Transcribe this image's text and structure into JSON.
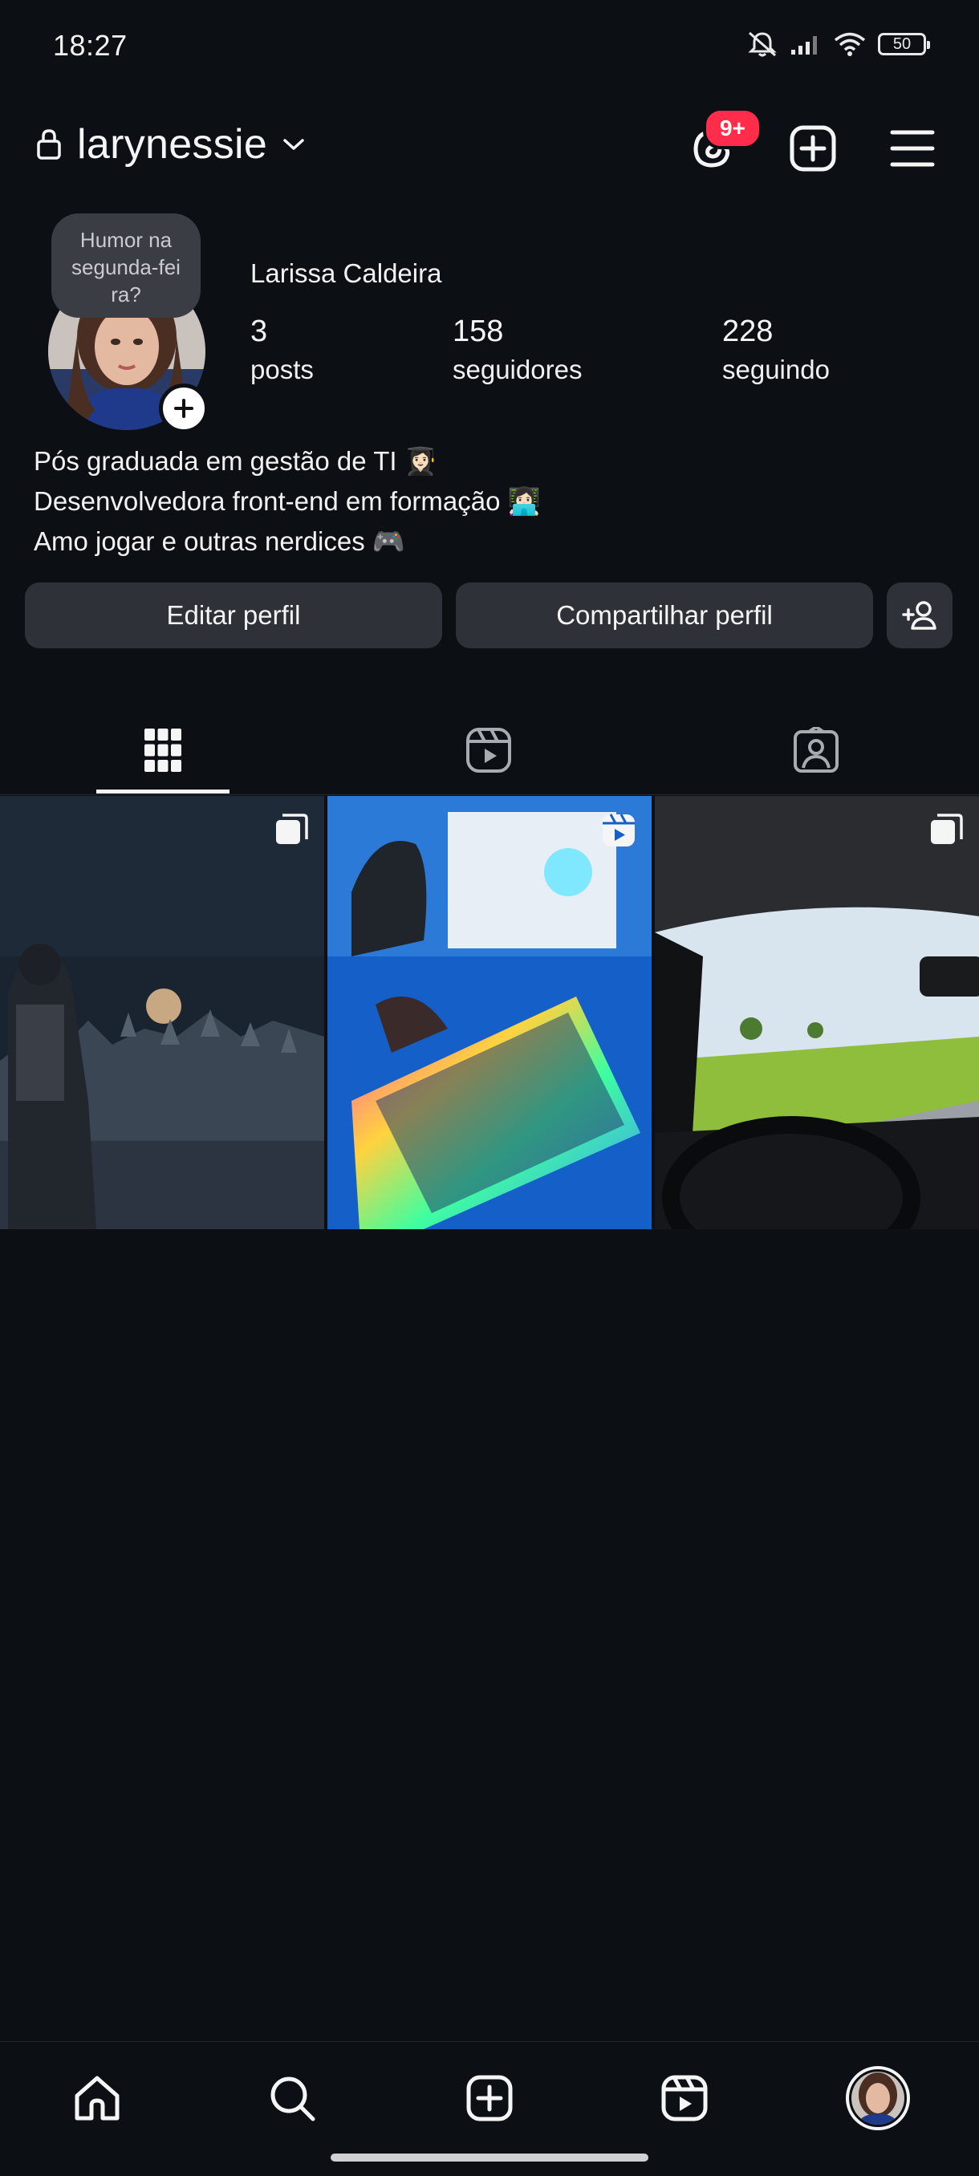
{
  "status_bar": {
    "time": "18:27",
    "battery": "50",
    "icons": [
      "mute-icon",
      "signal-icon",
      "wifi-icon",
      "battery-icon"
    ]
  },
  "header": {
    "username": "larynessie",
    "notification_badge": "9+",
    "icons": [
      "lock-icon",
      "chevron-down-icon",
      "threads-icon",
      "new-post-icon",
      "menu-icon"
    ]
  },
  "profile": {
    "note": "Humor na segunda-fei ra?",
    "full_name": "Larissa Caldeira",
    "stats": [
      {
        "value": "3",
        "label": "posts"
      },
      {
        "value": "158",
        "label": "seguidores"
      },
      {
        "value": "228",
        "label": "seguindo"
      }
    ],
    "bio": [
      "Pós graduada em gestão de TI 👩🏻‍🎓",
      "Desenvolvedora front-end em formação 👩🏻‍💻",
      "Amo jogar e outras nerdices 🎮"
    ],
    "buttons": {
      "edit": "Editar perfil",
      "share": "Compartilhar perfil"
    }
  },
  "tabs": [
    {
      "name": "grid-tab",
      "icon": "grid-icon",
      "active": true
    },
    {
      "name": "reels-tab",
      "icon": "reels-icon",
      "active": false
    },
    {
      "name": "tagged-tab",
      "icon": "tagged-icon",
      "active": false
    }
  ],
  "posts": [
    {
      "type": "carousel",
      "icon": "carousel-icon"
    },
    {
      "type": "reel",
      "icon": "reel-icon"
    },
    {
      "type": "carousel",
      "icon": "carousel-icon"
    }
  ],
  "bottom_nav": [
    "home-icon",
    "search-icon",
    "create-icon",
    "reels-icon",
    "profile-avatar"
  ],
  "colors": {
    "background": "#0c0f14",
    "button": "#2e3137",
    "badge": "#ff2d4a"
  }
}
